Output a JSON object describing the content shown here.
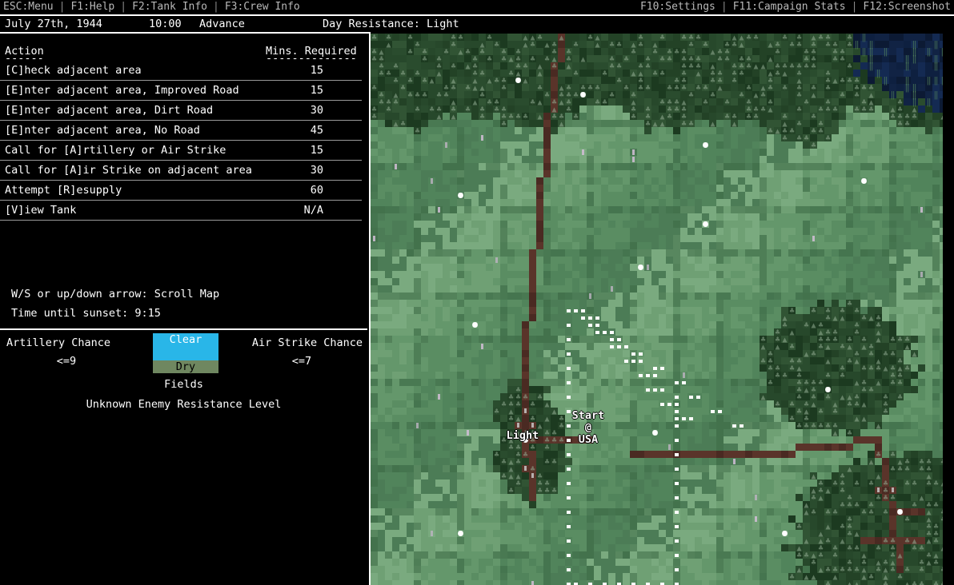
{
  "menubar": {
    "left_items": [
      {
        "label": "ESC:Menu"
      },
      {
        "label": "F1:Help"
      },
      {
        "label": "F2:Tank Info"
      },
      {
        "label": "F3:Crew Info"
      }
    ],
    "right_items": [
      {
        "label": "F10:Settings"
      },
      {
        "label": "F11:Campaign Stats"
      },
      {
        "label": "F12:Screenshot"
      }
    ],
    "separator": ":"
  },
  "status": {
    "date": "July 27th, 1944",
    "time": "10:00",
    "mode": "Advance",
    "resistance": "Day Resistance: Light"
  },
  "action_table": {
    "header_action": "Action",
    "header_mins": "Mins. Required",
    "dash_action": "------",
    "dash_mins": "--------------",
    "rows": [
      {
        "label": "[C]heck adjacent area",
        "mins": "15"
      },
      {
        "label": "[E]nter adjacent area, Improved Road",
        "mins": "15"
      },
      {
        "label": "[E]nter adjacent area, Dirt Road",
        "mins": "30"
      },
      {
        "label": "[E]nter adjacent area, No Road",
        "mins": "45"
      },
      {
        "label": "Call for [A]rtillery or Air Strike",
        "mins": "15"
      },
      {
        "label": "Call for [A]ir Strike on adjacent area",
        "mins": "30"
      },
      {
        "label": "Attempt [R]esupply",
        "mins": "60"
      },
      {
        "label": "[V]iew Tank",
        "mins": "N/A"
      }
    ]
  },
  "hints": {
    "scroll": "W/S or up/down arrow: Scroll Map",
    "sunset": "Time until sunset: 9:15"
  },
  "bottom_panel": {
    "artillery_label": "Artillery Chance",
    "artillery_value": "<=9",
    "air_label": "Air Strike Chance",
    "air_value": "<=7",
    "weather_sky": "Clear",
    "weather_ground": "Dry",
    "terrain": "Fields",
    "enemy": "Unknown Enemy Resistance Level"
  },
  "map": {
    "labels": [
      {
        "name": "start-marker",
        "text": "Start\n@\nUSA"
      },
      {
        "name": "village-light",
        "text": "Light"
      }
    ],
    "start_label": "Start\n@\nUSA",
    "village_label": "Light"
  },
  "colors": {
    "background": "#000000",
    "text": "#ffffff",
    "menu_text": "#b9b9b9",
    "rule": "#ffffff",
    "row_divider": "#9a9a9a",
    "weather_sky": "#29b6e8",
    "weather_ground": "#6f8760",
    "field_light": "#73a378",
    "field_mid": "#5f9267",
    "field_dark": "#4c7c56",
    "forest_dark": "#1f3c22",
    "forest_mid": "#2b4e2f",
    "road": "#5a342a",
    "water": "#0f2040",
    "marker_dot": "#ffffff"
  }
}
